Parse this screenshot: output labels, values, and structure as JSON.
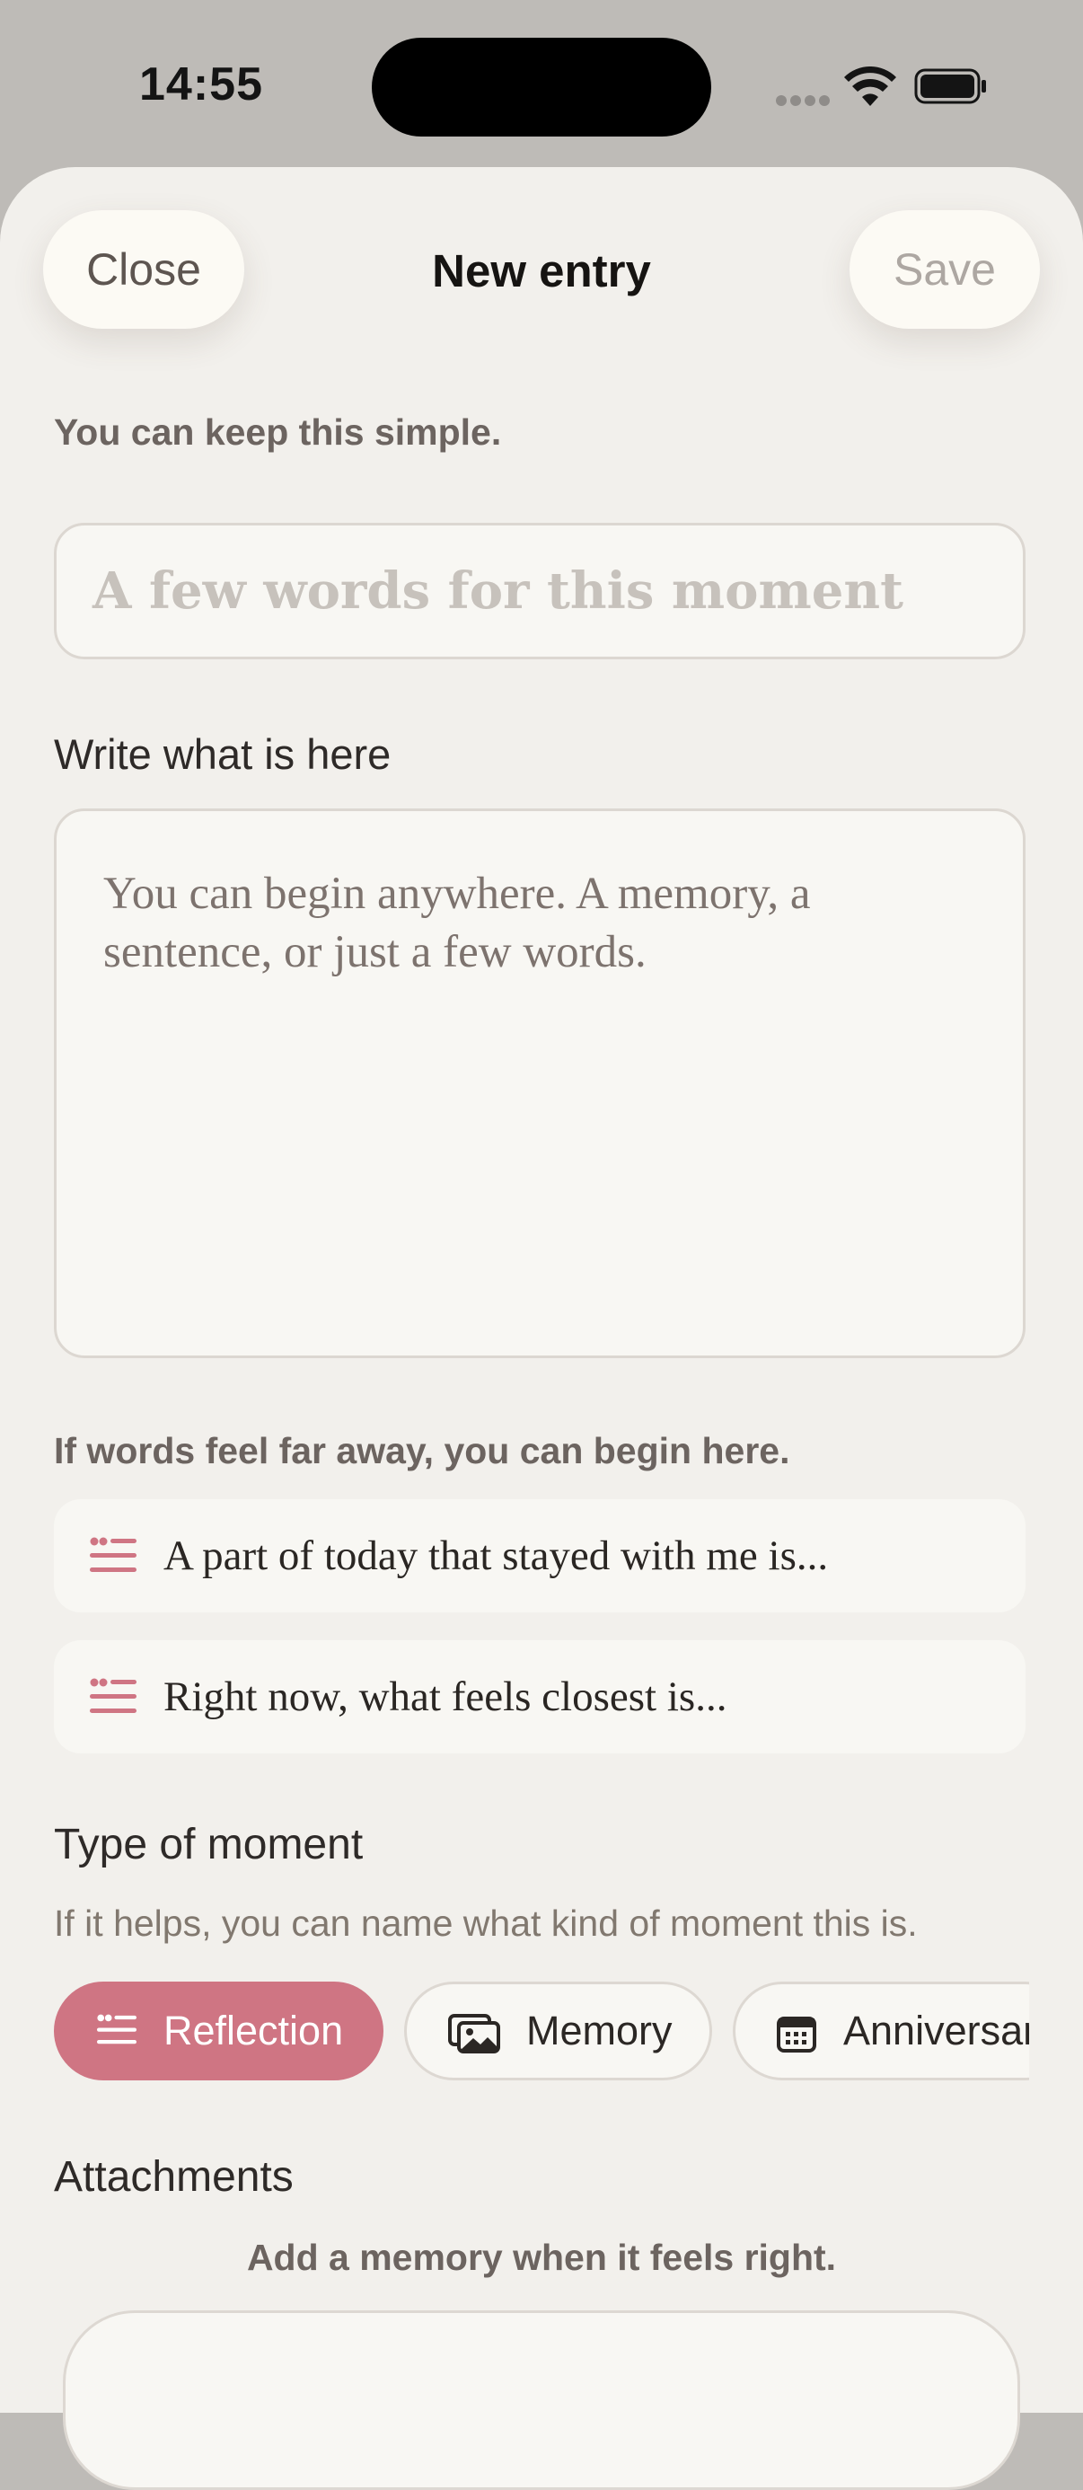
{
  "status_bar": {
    "time": "14:55"
  },
  "nav": {
    "close_label": "Close",
    "title": "New entry",
    "save_label": "Save"
  },
  "form": {
    "hint": "You can keep this simple.",
    "title_placeholder": "A few words for this moment",
    "write_label": "Write what is here",
    "body_placeholder": "You can begin anywhere. A memory, a sentence, or just a few words."
  },
  "prompts": {
    "hint": "If words feel far away, you can begin here.",
    "items": [
      {
        "icon": "quote-lines-icon",
        "text": "A part of today that stayed with me is..."
      },
      {
        "icon": "quote-lines-icon",
        "text": "Right now, what feels closest is..."
      }
    ]
  },
  "moment_type": {
    "title": "Type of moment",
    "subtitle": "If it helps, you can name what kind of moment this is.",
    "options": [
      {
        "label": "Reflection",
        "icon": "quote-lines-icon",
        "selected": true
      },
      {
        "label": "Memory",
        "icon": "photos-icon",
        "selected": false
      },
      {
        "label": "Anniversary",
        "icon": "calendar-icon",
        "selected": false
      }
    ]
  },
  "attachments": {
    "title": "Attachments",
    "subtitle": "Add a memory when it feels right."
  },
  "colors": {
    "accent": "#cf7583",
    "background": "#f2f0ec",
    "card": "#f8f7f3"
  }
}
